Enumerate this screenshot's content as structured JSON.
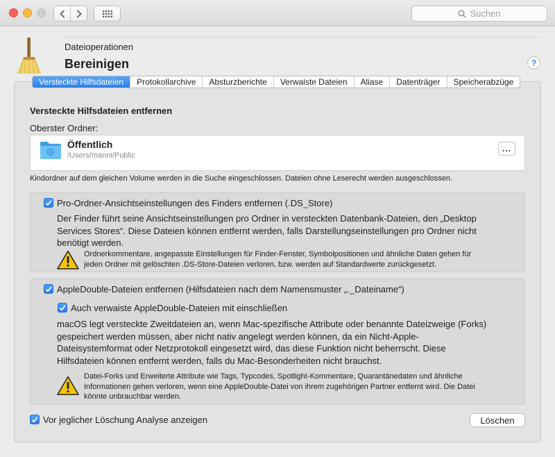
{
  "toolbar": {
    "back_icon": "chevron-left-icon",
    "forward_icon": "chevron-right-icon",
    "grid_icon": "grid-icon",
    "search_placeholder": "Suchen"
  },
  "header": {
    "subtitle": "Dateioperationen",
    "title": "Bereinigen",
    "help_label": "?"
  },
  "tabs": [
    {
      "label": "Versteckte Hilfsdateien",
      "active": true
    },
    {
      "label": "Protokollarchive",
      "active": false
    },
    {
      "label": "Absturzberichte",
      "active": false
    },
    {
      "label": "Verwaiste Dateien",
      "active": false
    },
    {
      "label": "Aliase",
      "active": false
    },
    {
      "label": "Datenträger",
      "active": false
    },
    {
      "label": "Speicherabzüge",
      "active": false
    }
  ],
  "section": {
    "title": "Versteckte Hilfsdateien entfernen",
    "folder_label": "Oberster Ordner:",
    "folder": {
      "name": "Öffentlich",
      "path": "/Users/manni/Public",
      "more_label": "..."
    },
    "note": "Kindordner auf dem gleichen Volume werden in die Suche eingeschlossen. Dateien ohne Leserecht werden ausgeschlossen."
  },
  "option_ds_store": {
    "checked": true,
    "label": "Pro-Ordner-Ansichtseinstellungen des Finders entfernen (.DS_Store)",
    "desc_lines": [
      "Der Finder führt seine Ansichtseinstellungen pro Ordner in versteckten Datenbank-Dateien, den „Desktop",
      "Services Stores“. Diese Dateien können entfernt werden, falls Darstellungseinstellungen pro Ordner nicht",
      "benötigt werden."
    ],
    "warning_lines": [
      "Ordnerkommentare, angepasste Einstellungen für Finder-Fenster, Symbolpositionen und ähnliche Daten gehen für",
      "jeden Ordner mit gelöschten .DS-Store-Dateien verloren, bzw. werden auf Standardwerte zurückgesetzt."
    ]
  },
  "option_appledouble": {
    "checked": true,
    "label": "AppleDouble-Dateien entfernen (Hilfsdateien nach dem Namensmuster „._Dateiname“)",
    "sub_option": {
      "checked": true,
      "label": "Auch verwaiste AppleDouble-Dateien mit einschließen"
    },
    "desc_lines": [
      "macOS legt versteckte Zweitdateien an, wenn Mac-spezifische Attribute oder benannte Dateizweige (Forks)",
      "gespeichert werden müssen, aber nicht nativ angelegt werden können, da ein Nicht-Apple-",
      "Dateisystemformat oder Netzprotokoll eingesetzt wird, das diese Funktion nicht beherrscht. Diese",
      "Hilfsdateien können entfernt werden, falls du Mac-Besonderheiten nicht brauchst."
    ],
    "warning_lines": [
      "Datei-Forks und Erweiterte Attribute wie Tags, Typcodes, Spotlight-Kommentare, Quarantänedaten und ähnliche",
      "Informationen gehen verloren, wenn eine AppleDouble-Datei von ihrem zugehörigen Partner entfernt wird. Die Datei",
      "könnte unbrauchbar werden."
    ]
  },
  "footer": {
    "analysis_checked": true,
    "analysis_label": "Vor jeglicher Löschung Analyse anzeigen",
    "delete_label": "Löschen"
  },
  "colors": {
    "accent": "#2d7fe8",
    "warning": "#f5c400",
    "folder": "#5ab4ef"
  }
}
